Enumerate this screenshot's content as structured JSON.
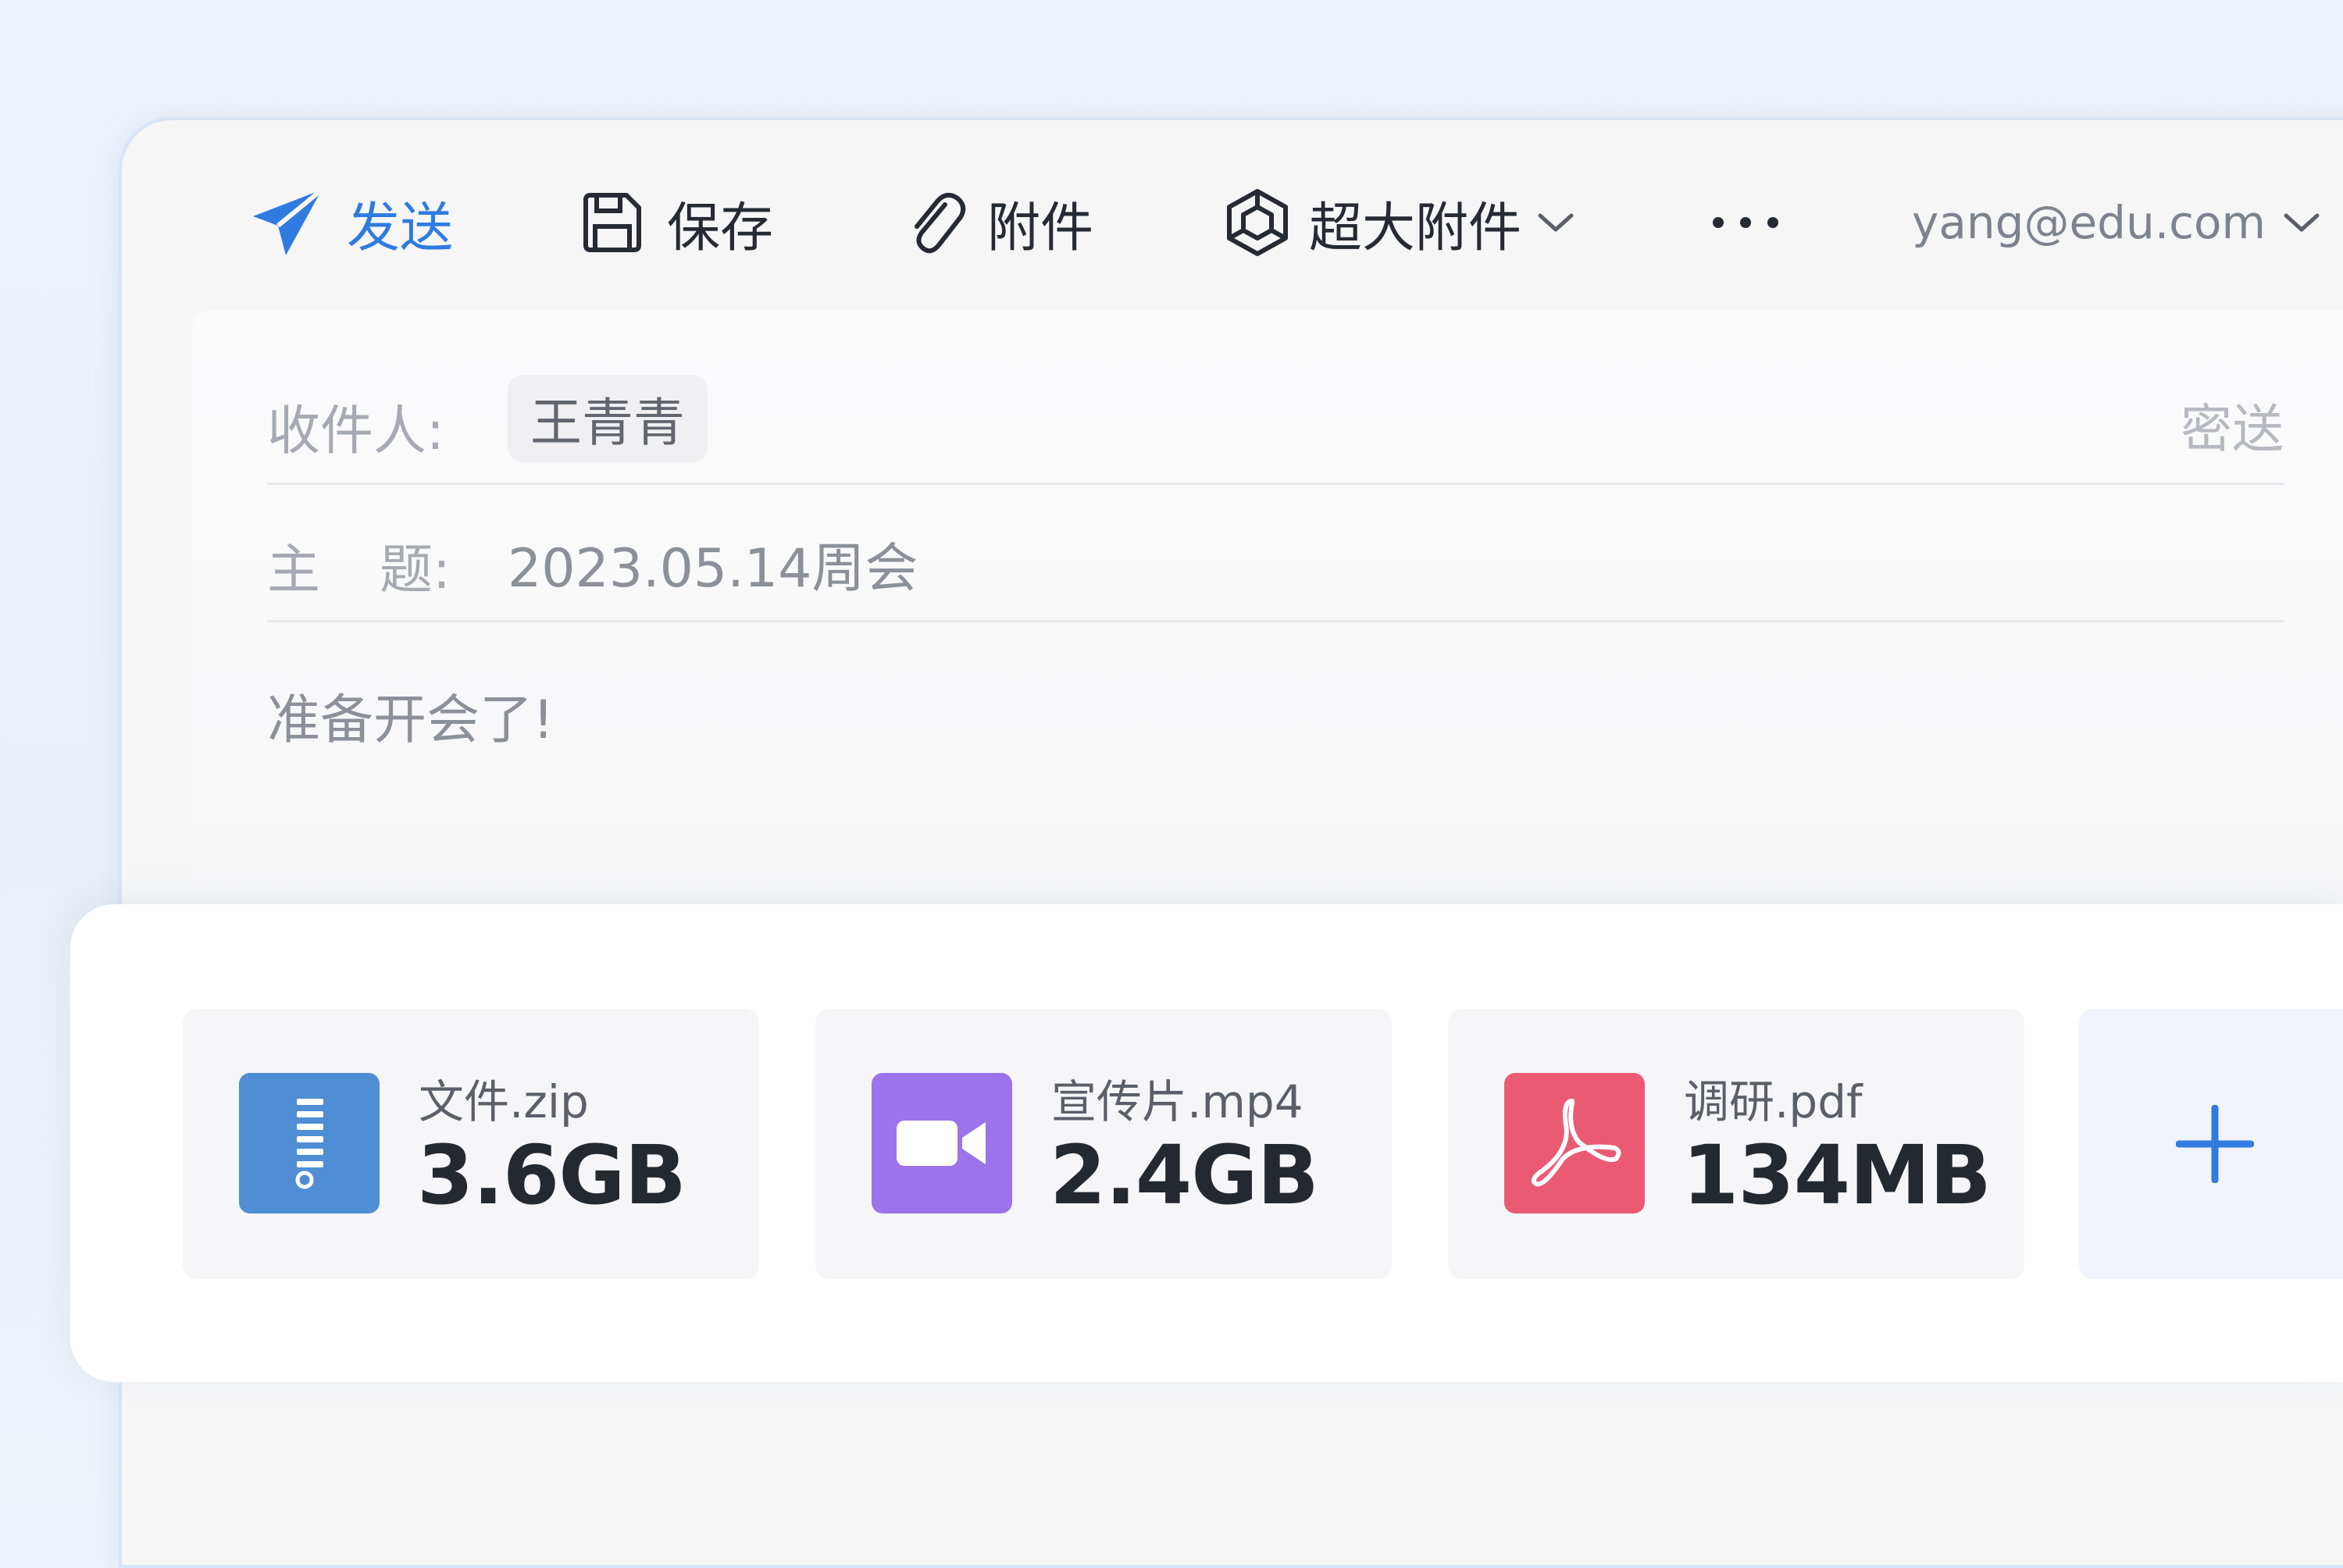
{
  "toolbar": {
    "send_label": "发送",
    "save_label": "保存",
    "attach_label": "附件",
    "big_attach_label": "超大附件",
    "more_icon": "ellipsis-icon",
    "account": "yang@edu.com"
  },
  "compose": {
    "recipient_label": "收件人:",
    "recipient": "王青青",
    "bcc_label": "密送",
    "subject_label_1": "主",
    "subject_label_2": "题:",
    "subject": "2023.05.14周会",
    "body": "准备开会了!"
  },
  "attachments": [
    {
      "name": "文件.zip",
      "size": "3.6GB",
      "type": "zip",
      "icon": "zip-file-icon",
      "color": "#4f8ed4"
    },
    {
      "name": "宣传片.mp4",
      "size": "2.4GB",
      "type": "video",
      "icon": "video-file-icon",
      "color": "#9c73e9"
    },
    {
      "name": "调研.pdf",
      "size": "134MB",
      "type": "pdf",
      "icon": "pdf-file-icon",
      "color": "#ea5b73"
    }
  ],
  "add_attachment_icon": "plus-icon",
  "colors": {
    "accent": "#2f7be0",
    "text_primary": "#262a33",
    "text_muted": "#8b9099"
  }
}
